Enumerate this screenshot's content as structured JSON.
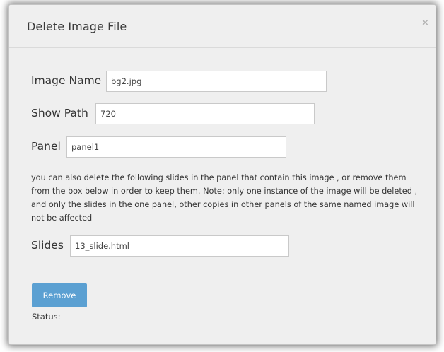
{
  "dialog": {
    "title": "Delete Image File",
    "close_symbol": "×"
  },
  "fields": {
    "image_name": {
      "label": "Image Name",
      "value": "bg2.jpg"
    },
    "show_path": {
      "label": "Show Path",
      "value": "720"
    },
    "panel": {
      "label": "Panel",
      "value": "panel1"
    },
    "slides": {
      "label": "Slides",
      "value": "13_slide.html"
    }
  },
  "description": "you can also delete the following slides in the panel that contain this image , or remove them from the box below in order to keep them. Note: only one instance of the image will be deleted , and only the slides in the one panel, other copies in other panels of the same named image will not be affected",
  "actions": {
    "remove_label": "Remove"
  },
  "status": {
    "label": "Status:"
  },
  "colors": {
    "button": "#5ba0d2",
    "dialog_bg": "#efefef"
  }
}
